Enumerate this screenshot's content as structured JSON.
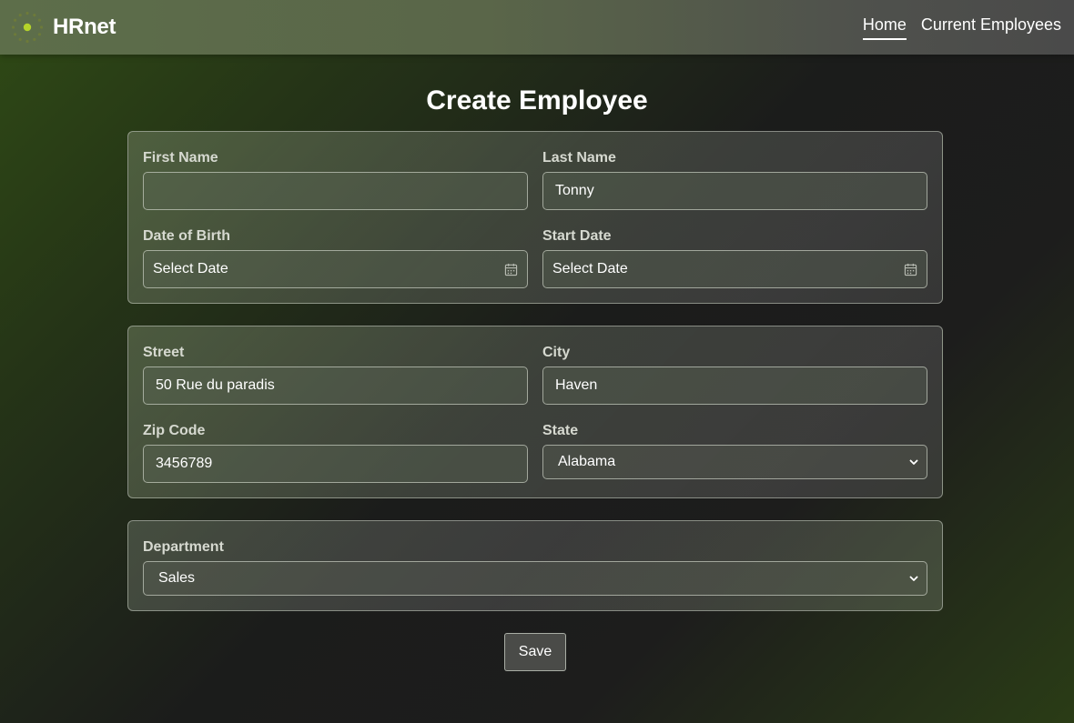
{
  "header": {
    "brand": "HRnet",
    "logo_icon": "spinner-dots-icon",
    "nav": [
      {
        "label": "Home",
        "active": true
      },
      {
        "label": "Current Employees",
        "active": false
      }
    ]
  },
  "page_title": "Create Employee",
  "identity": {
    "first_name": {
      "label": "First Name",
      "value": ""
    },
    "last_name": {
      "label": "Last Name",
      "value": "Tonny"
    },
    "date_of_birth": {
      "label": "Date of Birth",
      "value": "Select Date",
      "icon": "calendar-icon"
    },
    "start_date": {
      "label": "Start Date",
      "value": "Select Date",
      "icon": "calendar-icon"
    }
  },
  "address": {
    "street": {
      "label": "Street",
      "value": "50 Rue du paradis"
    },
    "city": {
      "label": "City",
      "value": "Haven"
    },
    "zip": {
      "label": "Zip Code",
      "value": "3456789"
    },
    "state": {
      "label": "State",
      "value": "Alabama",
      "icon": "chevron-down-icon"
    }
  },
  "department": {
    "label": "Department",
    "value": "Sales",
    "icon": "chevron-down-icon"
  },
  "save_label": "Save",
  "colors": {
    "logo_accent": "#b5d32a",
    "logo_dots": "#6d7a3a"
  }
}
